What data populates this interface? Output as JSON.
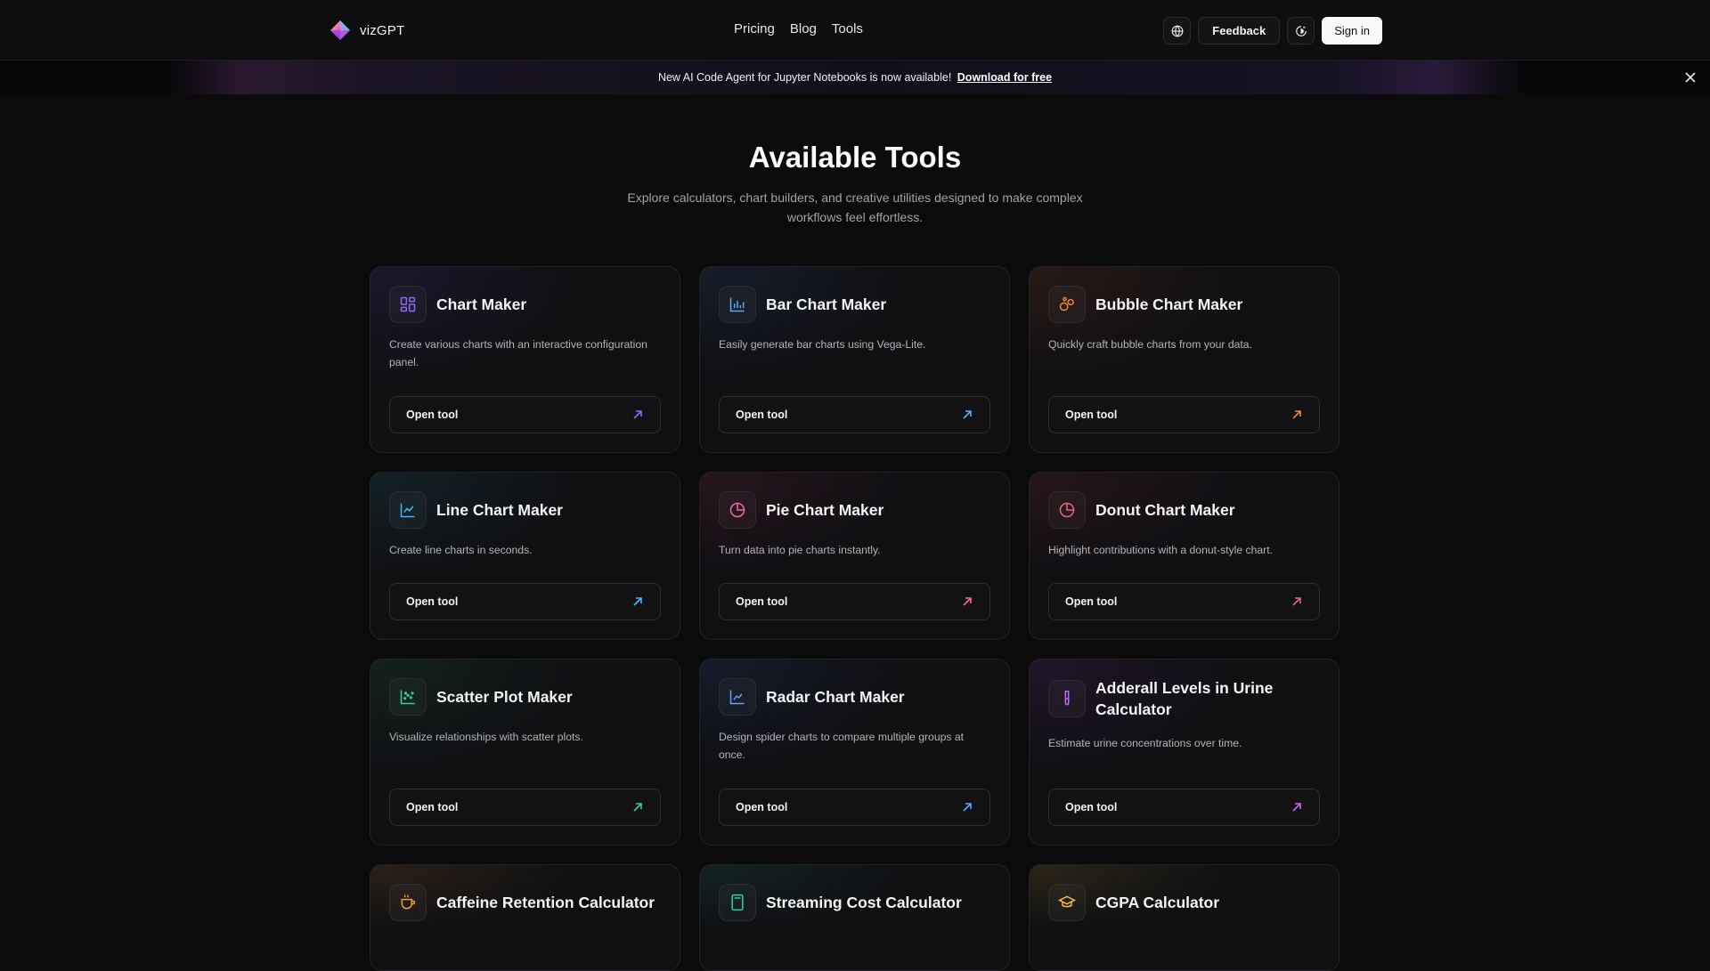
{
  "brand": {
    "name": "vizGPT"
  },
  "nav": {
    "links": [
      "Pricing",
      "Blog",
      "Tools"
    ],
    "feedback": "Feedback",
    "signin": "Sign in"
  },
  "banner": {
    "text": "New AI Code Agent for Jupyter Notebooks is now available!",
    "link": "Download for free"
  },
  "hero": {
    "title": "Available Tools",
    "subtitle": "Explore calculators, chart builders, and creative utilities designed to make complex workflows feel effortless."
  },
  "open_label": "Open tool",
  "tools": [
    {
      "title": "Chart Maker",
      "desc": "Create various charts with an interactive configuration panel.",
      "icon": "grid-icon",
      "color": "#8b6cf6",
      "tint": "rgba(88,62,180,0.16)"
    },
    {
      "title": "Bar Chart Maker",
      "desc": "Easily generate bar charts using Vega-Lite.",
      "icon": "bar-chart-icon",
      "color": "#5fa8f5",
      "tint": "rgba(50,100,170,0.16)"
    },
    {
      "title": "Bubble Chart Maker",
      "desc": "Quickly craft bubble charts from your data.",
      "icon": "bubble-chart-icon",
      "color": "#f0843c",
      "tint": "rgba(170,80,40,0.16)"
    },
    {
      "title": "Line Chart Maker",
      "desc": "Create line charts in seconds.",
      "icon": "line-chart-icon",
      "color": "#38bdf8",
      "tint": "rgba(30,130,150,0.16)"
    },
    {
      "title": "Pie Chart Maker",
      "desc": "Turn data into pie charts instantly.",
      "icon": "pie-chart-icon",
      "color": "#f06aa0",
      "tint": "rgba(170,50,90,0.16)"
    },
    {
      "title": "Donut Chart Maker",
      "desc": "Highlight contributions with a donut-style chart.",
      "icon": "donut-chart-icon",
      "color": "#f0627a",
      "tint": "rgba(160,50,70,0.16)"
    },
    {
      "title": "Scatter Plot Maker",
      "desc": "Visualize relationships with scatter plots.",
      "icon": "scatter-plot-icon",
      "color": "#34d399",
      "tint": "rgba(30,130,90,0.16)"
    },
    {
      "title": "Radar Chart Maker",
      "desc": "Design spider charts to compare multiple groups at once.",
      "icon": "radar-chart-icon",
      "color": "#60a5fa",
      "tint": "rgba(50,90,170,0.16)"
    },
    {
      "title": "Adderall Levels in Urine Calculator",
      "desc": "Estimate urine concentrations over time.",
      "icon": "test-tube-icon",
      "color": "#c06cf0",
      "tint": "rgba(120,50,170,0.16)"
    },
    {
      "title": "Caffeine Retention Calculator",
      "desc": "",
      "icon": "coffee-cup-icon",
      "color": "#f59e3c",
      "tint": "rgba(170,110,40,0.18)"
    },
    {
      "title": "Streaming Cost Calculator",
      "desc": "",
      "icon": "calculator-icon",
      "color": "#34d3a0",
      "tint": "rgba(30,130,100,0.18)"
    },
    {
      "title": "CGPA Calculator",
      "desc": "",
      "icon": "graduation-cap-icon",
      "color": "#f5c242",
      "tint": "rgba(170,140,40,0.18)"
    }
  ]
}
